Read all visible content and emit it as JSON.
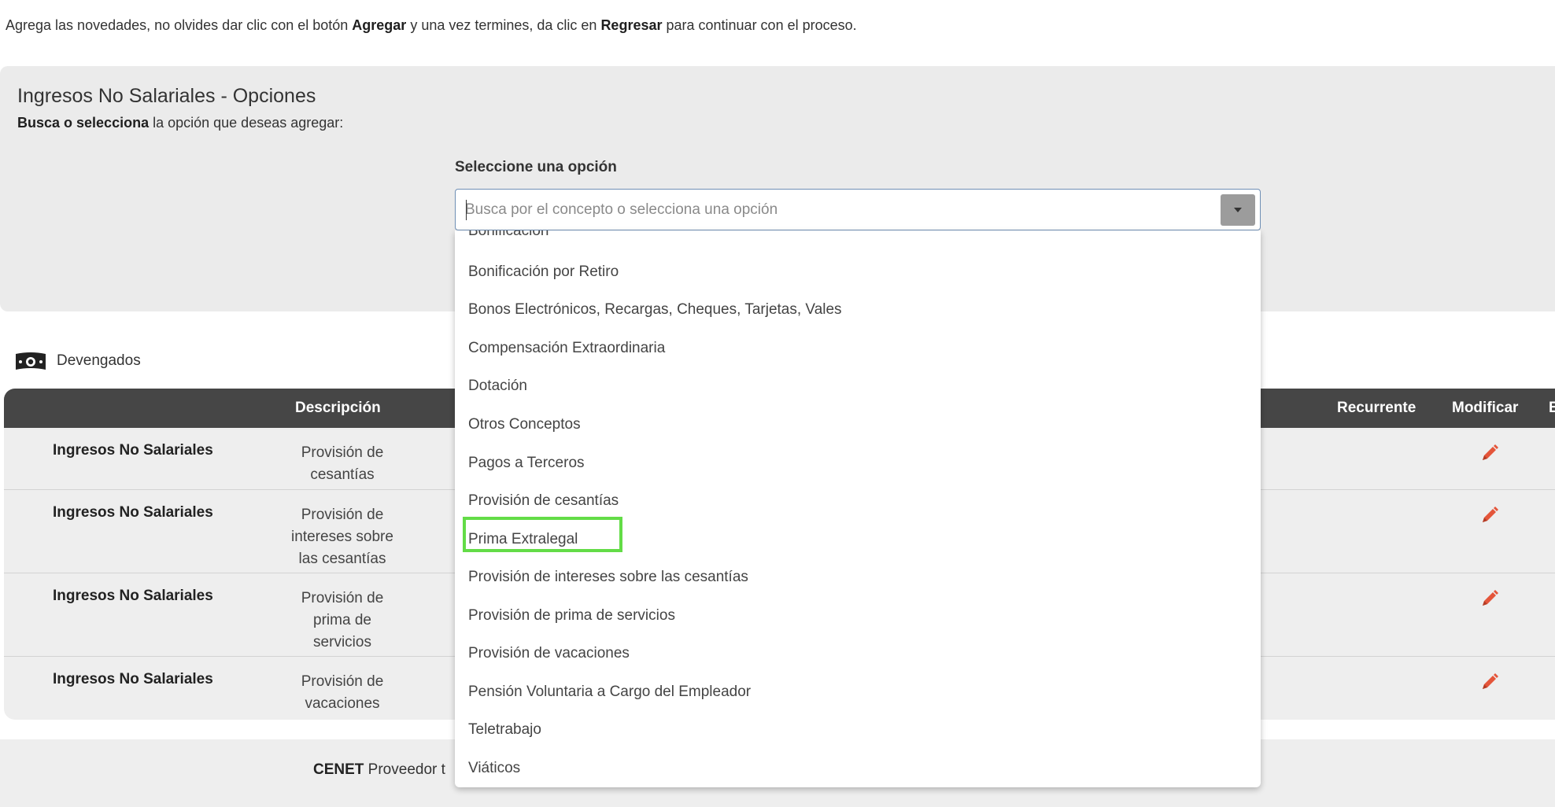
{
  "instruction": {
    "part1": "Agrega las novedades, no olvides dar clic con el botón ",
    "agregar": "Agregar",
    "part2": " y una vez termines, da clic en ",
    "regresar": "Regresar",
    "part3": " para continuar con el proceso."
  },
  "panel": {
    "title": "Ingresos No Salariales - Opciones",
    "sub_bold": "Busca o selecciona",
    "sub_rest": " la opción que deseas agregar:",
    "select_label": "Seleccione una opción",
    "placeholder": "Busca por el concepto o selecciona una opción",
    "options": [
      "Bonificación",
      "Bonificación por Retiro",
      "Bonos Electrónicos, Recargas, Cheques, Tarjetas, Vales",
      "Compensación Extraordinaria",
      "Dotación",
      "Otros Conceptos",
      "Pagos a Terceros",
      "Provisión de cesantías",
      "Prima Extralegal",
      "Provisión de intereses sobre las cesantías",
      "Provisión de prima de servicios",
      "Provisión de vacaciones",
      "Pensión Voluntaria a Cargo del Empleador",
      "Teletrabajo",
      "Viáticos"
    ],
    "highlighted_option": "Prima Extralegal",
    "highlight_color": "#63dc47"
  },
  "devengados": {
    "label": "Devengados",
    "icon": "money-icon"
  },
  "table": {
    "headers": {
      "descripcion": "Descripción",
      "recurrente": "Recurrente",
      "modificar": "Modificar",
      "cut": "E"
    },
    "rows": [
      {
        "type": "Ingresos No Salariales",
        "desc": [
          "Provisión de",
          "cesantías"
        ]
      },
      {
        "type": "Ingresos No Salariales",
        "desc": [
          "Provisión de",
          "intereses sobre",
          "las cesantías"
        ]
      },
      {
        "type": "Ingresos No Salariales",
        "desc": [
          "Provisión de",
          "prima de",
          "servicios"
        ]
      },
      {
        "type": "Ingresos No Salariales",
        "desc": [
          "Provisión de",
          "vacaciones"
        ]
      }
    ],
    "edit_icon": "pencil-icon",
    "edit_color": "#e4553a",
    "header_bg": "#464646"
  },
  "footer": {
    "brand": "CENET",
    "text": " Proveedor t"
  }
}
